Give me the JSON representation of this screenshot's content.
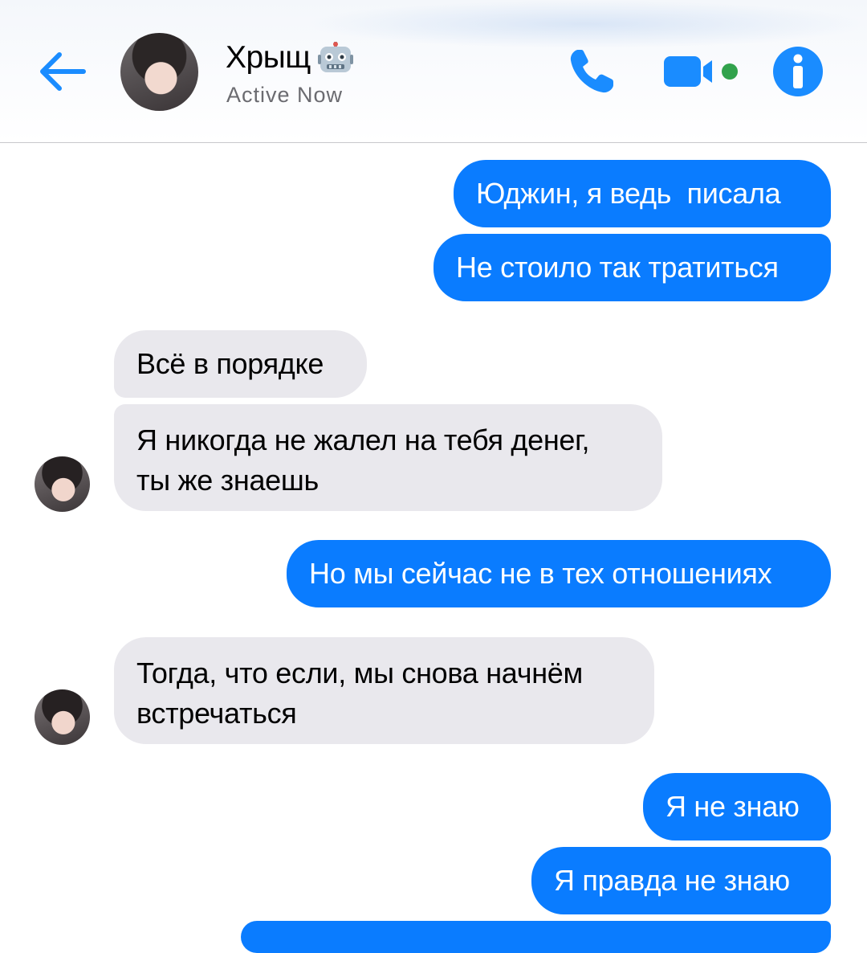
{
  "header": {
    "contact_name": "Хрыщ",
    "status": "Active Now"
  },
  "icons": {
    "back": "back-arrow-icon",
    "call": "phone-icon",
    "video": "video-camera-icon",
    "info": "info-icon",
    "name_emoji": "robot-icon"
  },
  "colors": {
    "accent": "#0a7cff",
    "outgoing_bubble": "#0a7cff",
    "incoming_bubble": "#e9e8ed",
    "active_dot": "#31a24c"
  },
  "messages": [
    {
      "direction": "outgoing",
      "text": "Юджин, я ведь  писала"
    },
    {
      "direction": "outgoing",
      "text": "Не стоило так тратиться"
    },
    {
      "direction": "incoming",
      "text": "Всё в порядке"
    },
    {
      "direction": "incoming",
      "text": "Я никогда не жалел на тебя денег,\nты же знаешь"
    },
    {
      "direction": "outgoing",
      "text": "Но мы сейчас не в тех отношениях"
    },
    {
      "direction": "incoming",
      "text": "Тогда, что если, мы снова начнём\nвстречаться"
    },
    {
      "direction": "outgoing",
      "text": "Я не знаю"
    },
    {
      "direction": "outgoing",
      "text": "Я правда не знаю"
    }
  ]
}
